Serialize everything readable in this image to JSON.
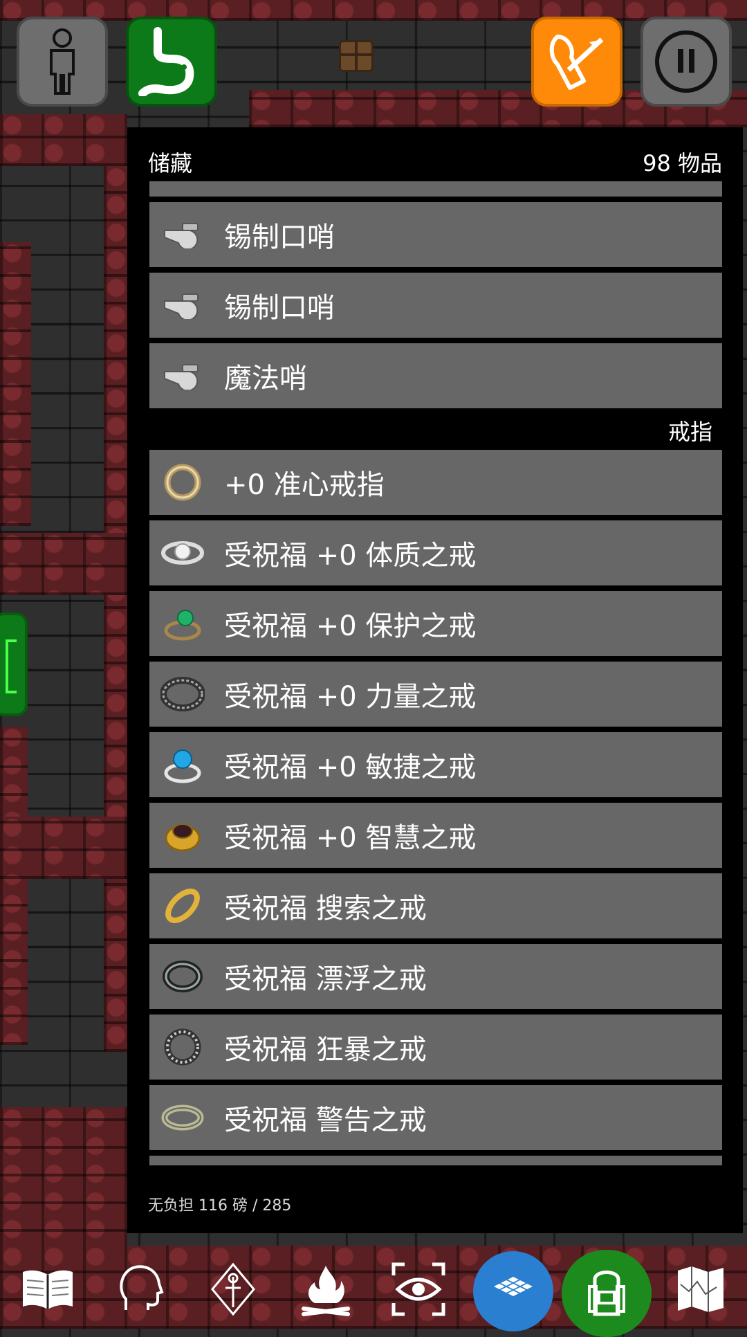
{
  "panel": {
    "title": "储藏",
    "count": "98 物品",
    "footer": "无负担 116 磅 / 285"
  },
  "items_top": [
    {
      "label": "锡制口哨",
      "icon": "whistle-icon"
    },
    {
      "label": "锡制口哨",
      "icon": "whistle-icon"
    },
    {
      "label": "魔法哨",
      "icon": "whistle-icon"
    }
  ],
  "category_rings": "戒指",
  "items_rings": [
    {
      "label": "+0 准心戒指",
      "icon": "ring-icon"
    },
    {
      "label": "受祝福 +0 体质之戒",
      "icon": "ring-icon"
    },
    {
      "label": "受祝福 +0 保护之戒",
      "icon": "ring-icon"
    },
    {
      "label": "受祝福 +0 力量之戒",
      "icon": "ring-icon"
    },
    {
      "label": "受祝福 +0 敏捷之戒",
      "icon": "ring-icon"
    },
    {
      "label": "受祝福 +0 智慧之戒",
      "icon": "ring-icon"
    },
    {
      "label": "受祝福 搜索之戒",
      "icon": "ring-icon"
    },
    {
      "label": "受祝福 漂浮之戒",
      "icon": "ring-icon"
    },
    {
      "label": "受祝福 狂暴之戒",
      "icon": "ring-icon"
    },
    {
      "label": "受祝福 警告之戒",
      "icon": "ring-icon"
    }
  ],
  "colors": {
    "hunger_green": "#0c7a18",
    "fire_orange": "#ff8a0a",
    "ring_blue": "#2a7fd0",
    "bag_green": "#1d8a1d",
    "row_gray": "#676767"
  }
}
